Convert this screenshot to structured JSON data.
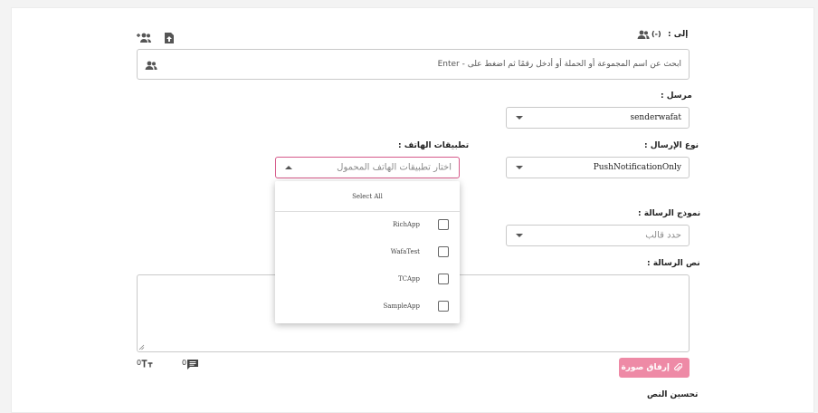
{
  "recipients": {
    "label": "إلى :",
    "count": "(-)",
    "search_placeholder": "ابحث عن اسم المجموعة أو الحملة أو أدخل رقمًا ثم اضغط على - Enter"
  },
  "sender": {
    "label": "مرسل :",
    "value": "senderwafat"
  },
  "send_type": {
    "label": "نوع الإرسال :",
    "value": "PushNotificationOnly"
  },
  "phone_apps": {
    "label": "تطبيقات الهاتف :",
    "placeholder": "اختار تطبيقات الهاتف المحمول",
    "select_all": "Select All",
    "options": [
      {
        "label": "RichApp",
        "checked": false
      },
      {
        "label": "WafaTest",
        "checked": false
      },
      {
        "label": "TCApp",
        "checked": false
      },
      {
        "label": "SampleApp",
        "checked": false
      }
    ]
  },
  "template": {
    "label": "نموذج الرسالة :",
    "placeholder": "حدد قالب"
  },
  "message": {
    "label": "نص الرسالة :",
    "char_count": "0",
    "sms_count": "0"
  },
  "attach_button_label": "إرفاق صورة",
  "improve_text_label": "تحسين النص",
  "colors": {
    "accent_pink": "#ee8aa6",
    "dropdown_border": "#d65a8a"
  },
  "icons": [
    "add-group-icon",
    "file-upload-icon",
    "group-icon",
    "caret-down-icon",
    "caret-up-icon",
    "text-size-icon",
    "chat-icon",
    "paperclip-icon",
    "resize-icon"
  ]
}
